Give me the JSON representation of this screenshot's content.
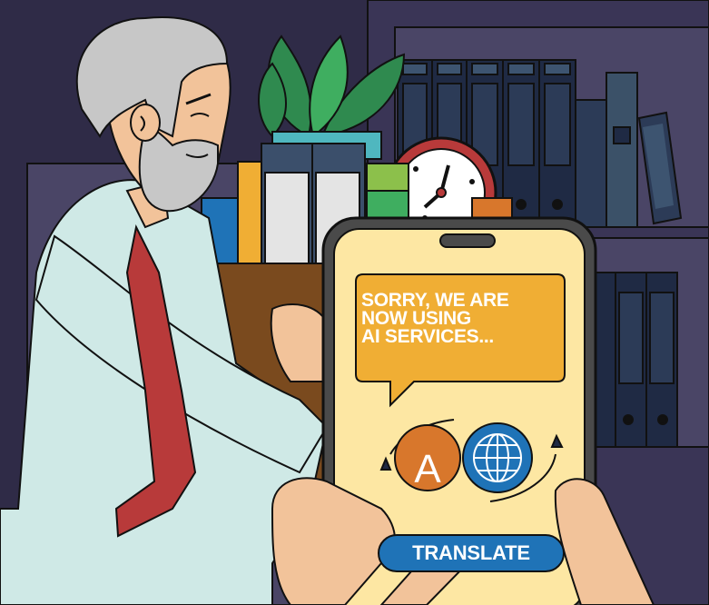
{
  "scene": {
    "phone": {
      "message_lines": [
        "SORRY, WE ARE",
        "NOW USING",
        "AI SERVICES..."
      ],
      "source_language_letter": "A",
      "translate_button_label": "TRANSLATE"
    },
    "icons": [
      "speech-bubble-icon",
      "letter-a-icon",
      "globe-icon",
      "swap-arrows-icon"
    ],
    "colors": {
      "background_dark": "#2f2b47",
      "shelf": "#4a4566",
      "phone_screen": "#fde7a3",
      "bubble": "#f0ae34",
      "globe": "#1f73b7",
      "letter_circle": "#d8772c",
      "shirt": "#cfe9e6",
      "tie": "#b83a3a",
      "box": "#7a4a1e",
      "hair": "#c7c7c7",
      "skin": "#f2c39a"
    }
  }
}
